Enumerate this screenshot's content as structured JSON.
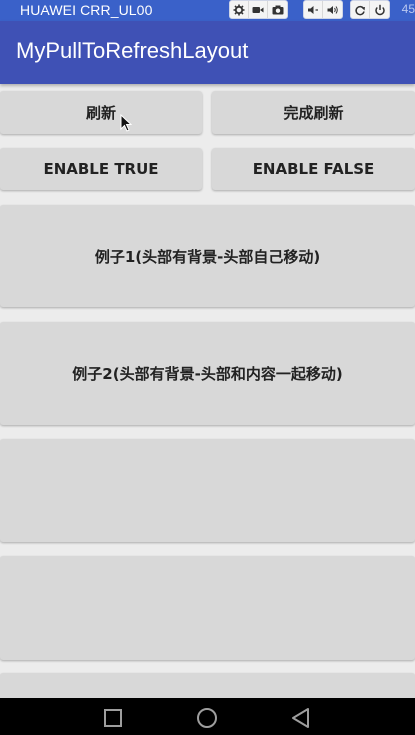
{
  "status": {
    "device": "HUAWEI CRR_UL00",
    "time": "45"
  },
  "toolbar_icons": [
    "settings-icon",
    "video-icon",
    "camera-icon",
    "volume-down-icon",
    "volume-up-icon",
    "rotate-icon",
    "power-icon"
  ],
  "appbar": {
    "title": "MyPullToRefreshLayout"
  },
  "buttons": {
    "refresh": "刷新",
    "finish_refresh": "完成刷新",
    "enable_true": "ENABLE TRUE",
    "enable_false": "ENABLE FALSE",
    "example1": "例子1(头部有背景-头部自己移动)",
    "example2": "例子2(头部有背景-头部和内容一起移动)",
    "example3": "",
    "example4": "",
    "example5": ""
  },
  "navbar_icons": [
    "back-icon",
    "home-icon",
    "recents-icon"
  ],
  "colors": {
    "statusbar": "#3a61c9",
    "appbar": "#3f51b5",
    "button": "#d8d8d8",
    "background": "#ececec"
  }
}
